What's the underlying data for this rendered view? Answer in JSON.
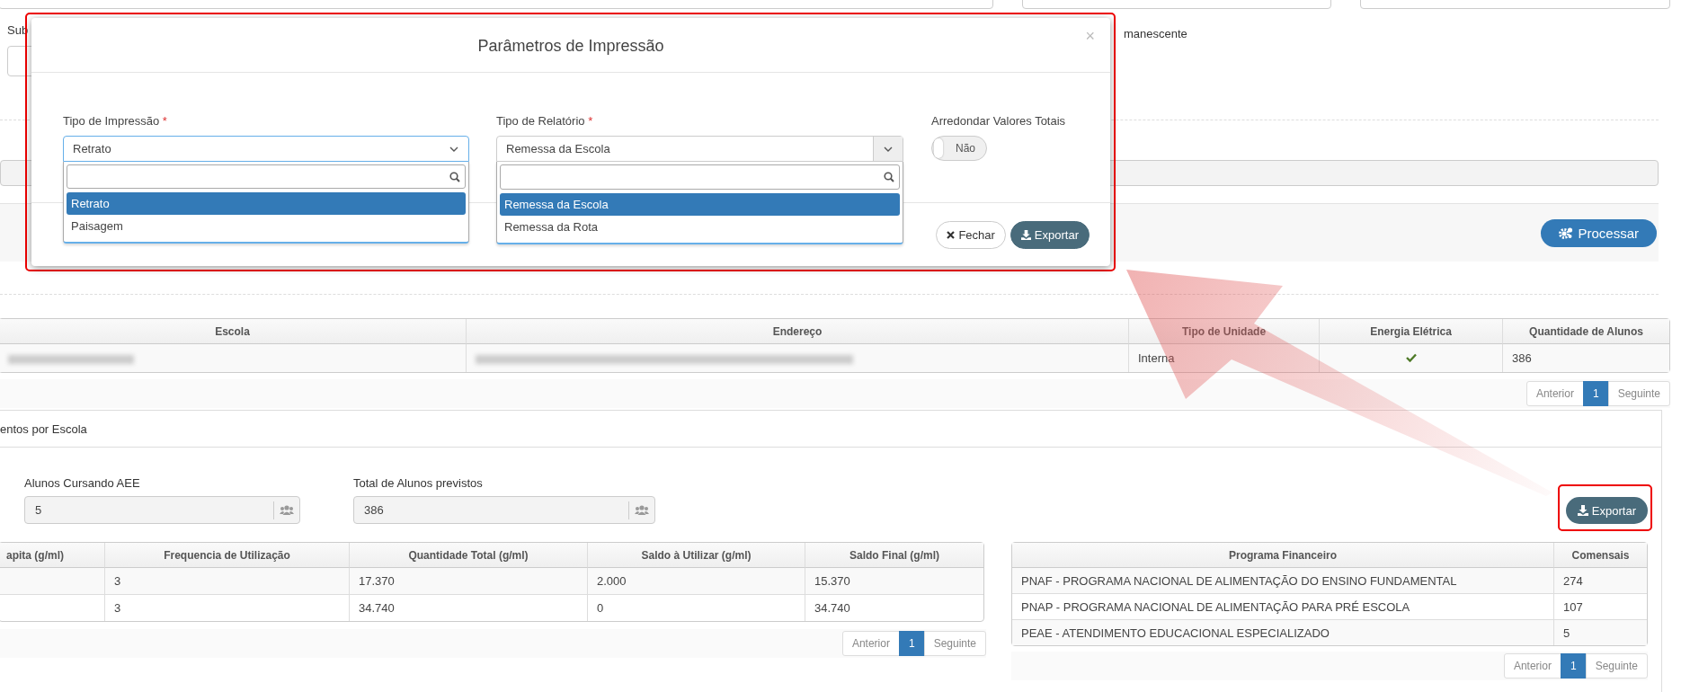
{
  "background_form": {
    "labels": [
      "Sub",
      "manescente"
    ]
  },
  "processar_button": {
    "label": "Processar"
  },
  "schools_table": {
    "columns": [
      "Escola",
      "Endereço",
      "Tipo de Unidade",
      "Energia Elétrica",
      "Quantidade de Alunos"
    ],
    "rows": [
      {
        "cells": [
          {
            "kind": "redacted"
          },
          {
            "kind": "redacted"
          },
          {
            "kind": "text",
            "text": "Interna"
          },
          {
            "kind": "check",
            "checked": true
          },
          {
            "kind": "text",
            "text": "386"
          }
        ]
      }
    ]
  },
  "schools_pager": {
    "previous": "Anterior",
    "pages": [
      {
        "label": "1",
        "selected": true
      }
    ],
    "next": "Seguinte"
  },
  "panel": {
    "title": "entos por Escola",
    "fields": [
      {
        "label": "Alunos Cursando AEE",
        "value": "5"
      },
      {
        "label": "Total de Alunos previstos",
        "value": "386"
      }
    ],
    "export_button": {
      "label": "Exportar",
      "highlighted": true
    }
  },
  "consumption_table": {
    "columns": [
      "apita (g/ml)",
      "Frequencia de Utilização",
      "Quantidade Total (g/ml)",
      "Saldo à Utilizar (g/ml)",
      "Saldo Final (g/ml)"
    ],
    "rows": [
      [
        "",
        "3",
        "17.370",
        "2.000",
        "15.370"
      ],
      [
        "",
        "3",
        "34.740",
        "0",
        "34.740"
      ]
    ]
  },
  "consumption_pager": {
    "previous": "Anterior",
    "pages": [
      {
        "label": "1",
        "selected": true
      }
    ],
    "next": "Seguinte"
  },
  "program_table": {
    "columns": [
      "Programa Financeiro",
      "Comensais"
    ],
    "rows": [
      [
        "PNAF - PROGRAMA NACIONAL DE ALIMENTAÇÃO DO ENSINO FUNDAMENTAL",
        "274"
      ],
      [
        "PNAP - PROGRAMA NACIONAL DE ALIMENTAÇÃO PARA PRÉ ESCOLA",
        "107"
      ],
      [
        "PEAE - ATENDIMENTO EDUCACIONAL ESPECIALIZADO",
        "5"
      ]
    ]
  },
  "program_pager": {
    "previous": "Anterior",
    "pages": [
      {
        "label": "1",
        "selected": true
      }
    ],
    "next": "Seguinte"
  },
  "modal": {
    "title": "Parâmetros de Impressão",
    "close": "×",
    "highlighted": true,
    "selects": [
      {
        "label": "Tipo de Impressão",
        "required": "*",
        "value": "Retrato",
        "options": [
          {
            "label": "Retrato",
            "selected": true
          },
          {
            "label": "Paisagem",
            "selected": false
          }
        ]
      },
      {
        "label": "Tipo de Relatório",
        "required": "*",
        "value": "Remessa da Escola",
        "options": [
          {
            "label": "Remessa da Escola",
            "selected": true
          },
          {
            "label": "Remessa da Rota",
            "selected": false
          }
        ]
      }
    ],
    "toggle": {
      "label": "Arredondar Valores Totais",
      "value": "Não",
      "on": false
    },
    "buttons": [
      {
        "kind": "default",
        "label": "Fechar"
      },
      {
        "kind": "primary",
        "label": "Exportar"
      }
    ]
  }
}
